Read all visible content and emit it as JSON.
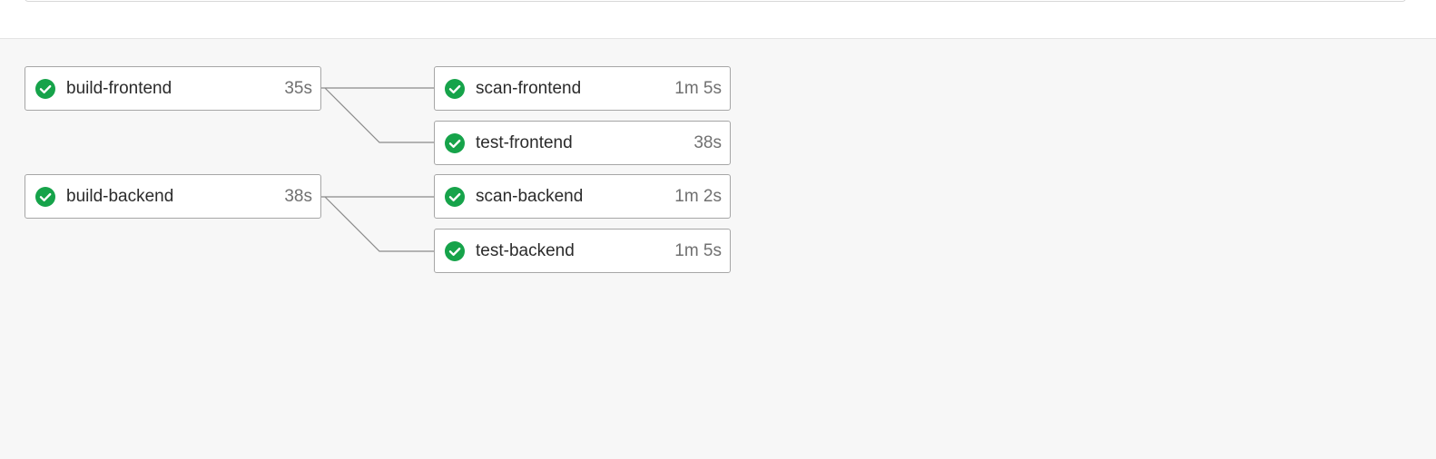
{
  "colors": {
    "success": "#16a34a",
    "border": "#a6a6a6",
    "connector": "#8a8a8a",
    "background": "#f7f7f7"
  },
  "pipeline": {
    "groups": [
      {
        "job": {
          "name": "build-frontend",
          "duration": "35s",
          "status": "success",
          "icon": "check-circle-icon"
        },
        "children": [
          {
            "name": "scan-frontend",
            "duration": "1m 5s",
            "status": "success",
            "icon": "check-circle-icon"
          },
          {
            "name": "test-frontend",
            "duration": "38s",
            "status": "success",
            "icon": "check-circle-icon"
          }
        ]
      },
      {
        "job": {
          "name": "build-backend",
          "duration": "38s",
          "status": "success",
          "icon": "check-circle-icon"
        },
        "children": [
          {
            "name": "scan-backend",
            "duration": "1m 2s",
            "status": "success",
            "icon": "check-circle-icon"
          },
          {
            "name": "test-backend",
            "duration": "1m 5s",
            "status": "success",
            "icon": "check-circle-icon"
          }
        ]
      }
    ]
  }
}
